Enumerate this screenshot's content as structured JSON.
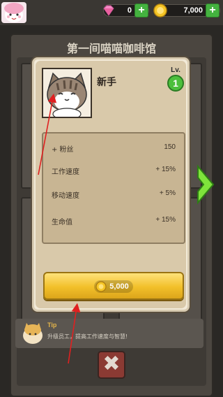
{
  "hud": {
    "gems": "0",
    "coins": "7,000",
    "plus_label": "+",
    "accent_green": "#44b23f"
  },
  "shop": {
    "title": "第一间喵喵咖啡馆",
    "tip_title": "Tip",
    "tip_text": "升级员工，提高工作速度与智慧!",
    "close_label": "✖"
  },
  "modal": {
    "cat_name": "新手",
    "level_label": "Lv.",
    "level_value": "1",
    "stats": [
      {
        "label": "+ 粉丝",
        "value": "150"
      },
      {
        "label": "工作速度",
        "value": "+ 15%"
      },
      {
        "label": "移动速度",
        "value": "+ 5%"
      },
      {
        "label": "生命值",
        "value": "+ 15%"
      }
    ],
    "buy_price": "5,000"
  },
  "icons": {
    "gem": "gem-icon",
    "coin": "coin-icon",
    "close": "close-icon",
    "arrow": "chevron-right-icon"
  }
}
